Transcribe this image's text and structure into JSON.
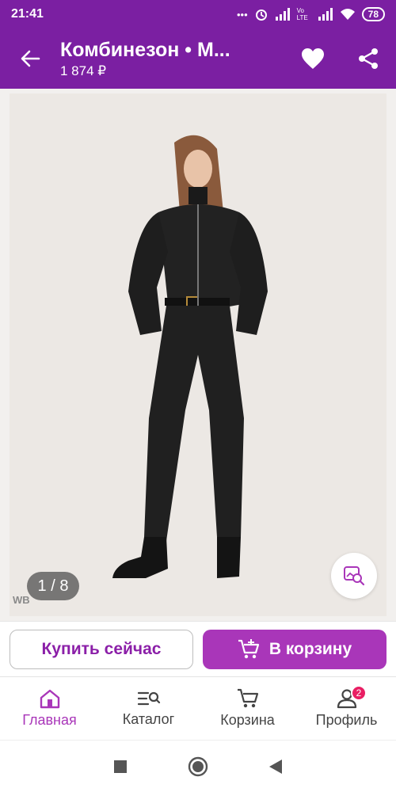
{
  "status_bar": {
    "time": "21:41",
    "battery": "78",
    "volte": "Vo LTE"
  },
  "header": {
    "title": "Комбинезон • M...",
    "price": "1 874 ₽",
    "icons": [
      "back-arrow-icon",
      "heart-icon",
      "share-icon"
    ]
  },
  "gallery": {
    "counter": "1 / 8",
    "watermark": "WB"
  },
  "actions": {
    "buy_now": "Купить сейчас",
    "add_to_cart": "В корзину"
  },
  "bottom_nav": {
    "items": [
      {
        "label": "Главная",
        "icon": "home-icon",
        "active": true
      },
      {
        "label": "Каталог",
        "icon": "catalog-search-icon",
        "active": false
      },
      {
        "label": "Корзина",
        "icon": "cart-icon",
        "active": false
      },
      {
        "label": "Профиль",
        "icon": "profile-icon",
        "active": false,
        "badge": "2"
      }
    ]
  },
  "colors": {
    "brand": "#7b1fa2",
    "accent": "#a936b9",
    "badge": "#e91e63"
  }
}
